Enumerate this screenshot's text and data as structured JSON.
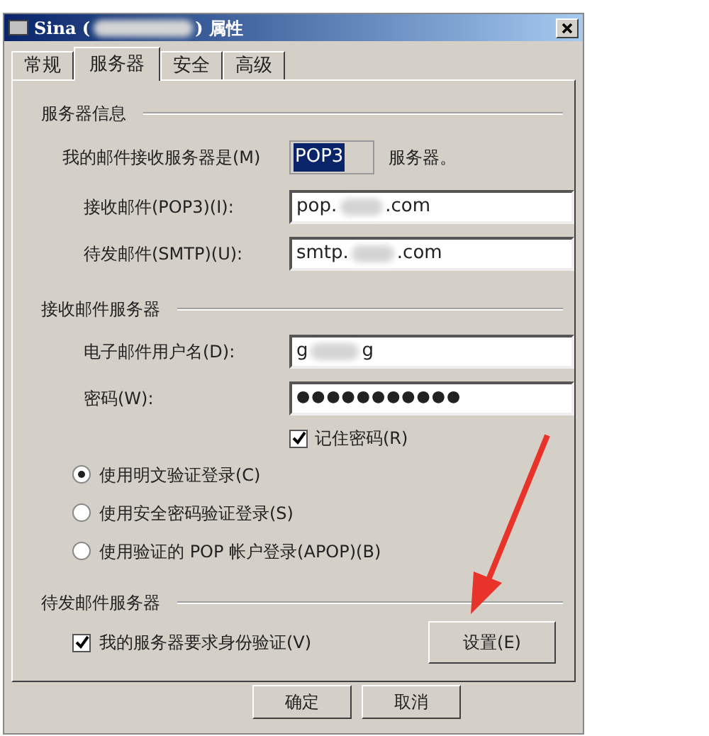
{
  "window": {
    "title_start": "Sina (",
    "title_end": ") 属性"
  },
  "tabs": [
    {
      "label": "常规",
      "selected": false
    },
    {
      "label": "服务器",
      "selected": true
    },
    {
      "label": "安全",
      "selected": false
    },
    {
      "label": "高级",
      "selected": false
    }
  ],
  "server_info": {
    "heading": "服务器信息",
    "incoming_type_label": "我的邮件接收服务器是(M)",
    "incoming_type": "POP3",
    "incoming_type_suffix": "服务器。",
    "fields": [
      {
        "label": "接收邮件(POP3)(I):",
        "value_start": "pop.",
        "value_end": ".com"
      },
      {
        "label": "待发邮件(SMTP)(U):",
        "value_start": "smtp.",
        "value_end": ".com"
      }
    ]
  },
  "incoming_server": {
    "heading": "接收邮件服务器",
    "username": {
      "label": "电子邮件用户名(D):",
      "value_start": "g",
      "value_end": "g"
    },
    "password": {
      "label": "密码(W):",
      "value": "●●●●●●●●●●●"
    },
    "remember": {
      "label": "记住密码(R)",
      "checked": true
    },
    "auth_options": [
      {
        "label": "使用明文验证登录(C)",
        "selected": true
      },
      {
        "label": "使用安全密码验证登录(S)",
        "selected": false
      },
      {
        "label": "使用验证的 POP 帐户登录(APOP)(B)",
        "selected": false
      }
    ]
  },
  "outgoing_server": {
    "heading": "待发邮件服务器",
    "requires_auth": {
      "label": "我的服务器要求身份验证(V)",
      "checked": true
    },
    "settings_button": "设置(E)"
  },
  "buttons": [
    "确定",
    "取消"
  ]
}
